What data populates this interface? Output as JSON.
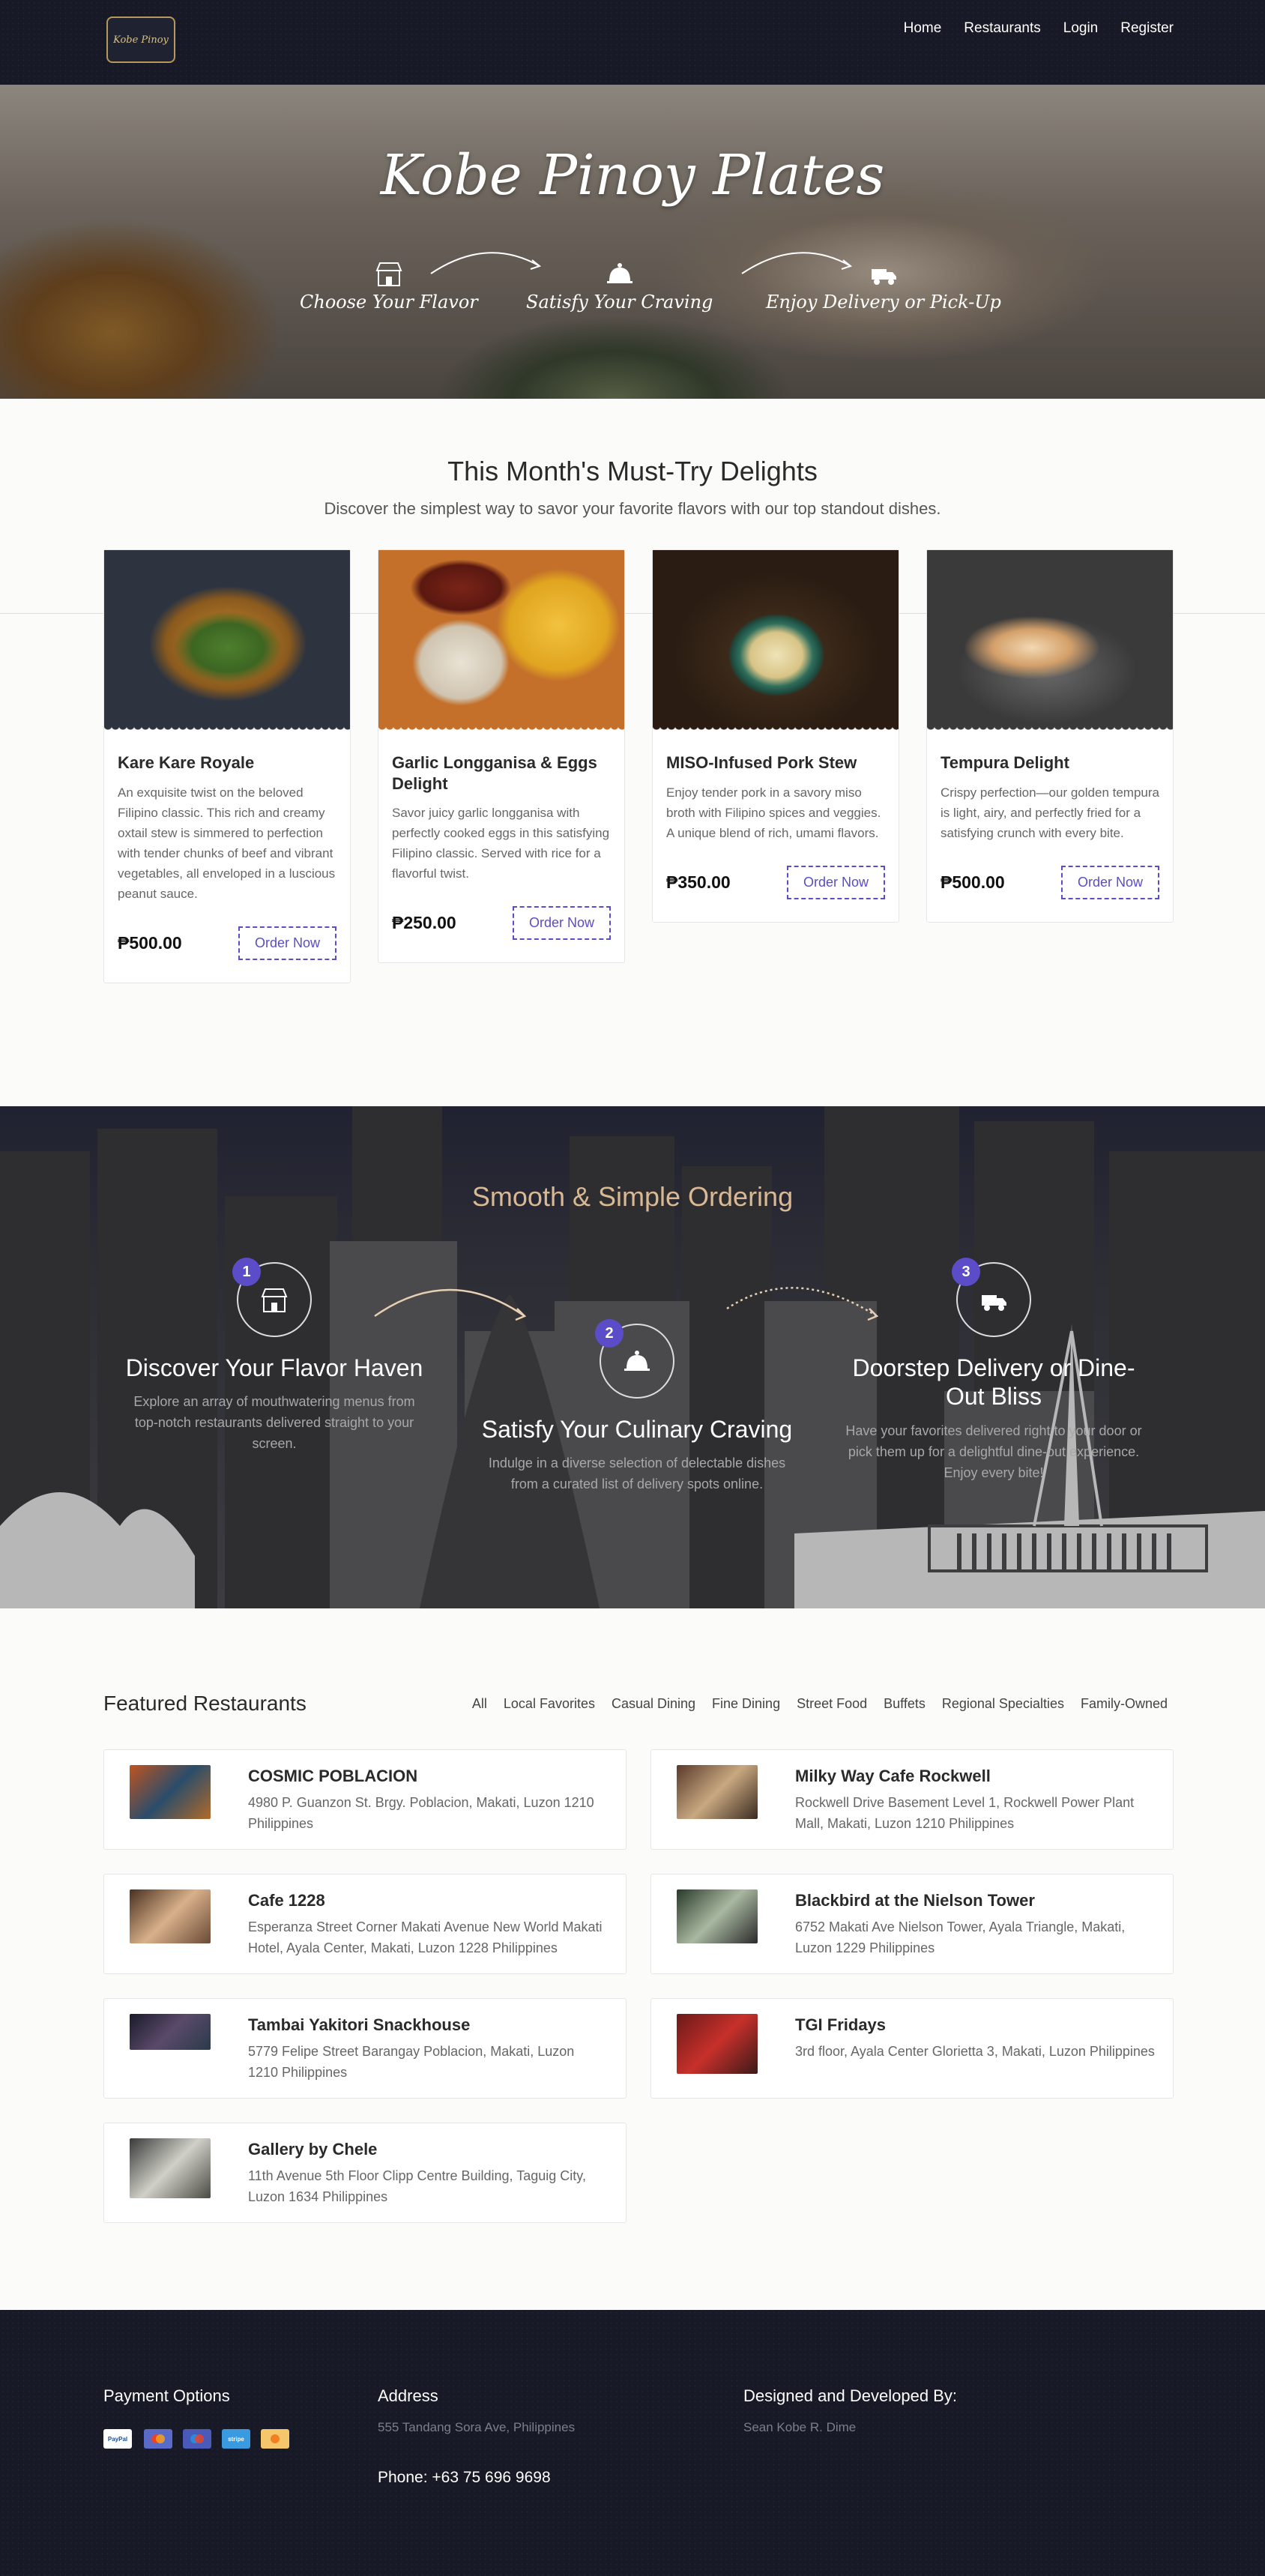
{
  "nav": {
    "logo_text": "Kobe Pinoy",
    "links": [
      "Home",
      "Restaurants",
      "Login",
      "Register"
    ]
  },
  "hero": {
    "title": "Kobe Pinoy Plates",
    "steps": [
      "Choose Your Flavor",
      "Satisfy Your Craving",
      "Enjoy Delivery or Pick-Up"
    ]
  },
  "must_try": {
    "title": "This Month's Must-Try Delights",
    "subtitle": "Discover the simplest way to savor your favorite flavors with our top standout dishes.",
    "dishes": [
      {
        "name": "Kare Kare Royale",
        "desc": "An exquisite twist on the beloved Filipino classic. This rich and creamy oxtail stew is simmered to perfection with tender chunks of beef and vibrant vegetables, all enveloped in a luscious peanut sauce.",
        "price": "₱500.00",
        "button": "Order Now"
      },
      {
        "name": "Garlic Longganisa & Eggs Delight",
        "desc": "Savor juicy garlic longganisa with perfectly cooked eggs in this satisfying Filipino classic. Served with rice for a flavorful twist.",
        "price": "₱250.00",
        "button": "Order Now"
      },
      {
        "name": "MISO-Infused Pork Stew",
        "desc": "Enjoy tender pork in a savory miso broth with Filipino spices and veggies. A unique blend of rich, umami flavors.",
        "price": "₱350.00",
        "button": "Order Now"
      },
      {
        "name": "Tempura Delight",
        "desc": "Crispy perfection—our golden tempura is light, airy, and perfectly fried for a satisfying crunch with every bite.",
        "price": "₱500.00",
        "button": "Order Now"
      }
    ]
  },
  "ordering": {
    "title": "Smooth & Simple Ordering",
    "steps": [
      {
        "num": "1",
        "title": "Discover Your Flavor Haven",
        "desc": "Explore an array of mouthwatering menus from top-notch restaurants delivered straight to your screen."
      },
      {
        "num": "2",
        "title": "Satisfy Your Culinary Craving",
        "desc": "Indulge in a diverse selection of delectable dishes from a curated list of delivery spots online."
      },
      {
        "num": "3",
        "title": "Doorstep Delivery or Dine-Out Bliss",
        "desc": "Have your favorites delivered right to your door or pick them up for a delightful dine-out experience. Enjoy every bite!"
      }
    ]
  },
  "featured": {
    "title": "Featured Restaurants",
    "filters": [
      "All",
      "Local Favorites",
      "Casual Dining",
      "Fine Dining",
      "Street Food",
      "Buffets",
      "Regional Specialties",
      "Family-Owned"
    ],
    "restaurants": [
      {
        "name": "COSMIC POBLACION",
        "address": "4980 P. Guanzon St. Brgy. Poblacion, Makati, Luzon 1210 Philippines"
      },
      {
        "name": "Milky Way Cafe Rockwell",
        "address": "Rockwell Drive Basement Level 1, Rockwell Power Plant Mall, Makati, Luzon 1210 Philippines"
      },
      {
        "name": "Cafe 1228",
        "address": "Esperanza Street Corner Makati Avenue New World Makati Hotel, Ayala Center, Makati, Luzon 1228 Philippines"
      },
      {
        "name": "Blackbird at the Nielson Tower",
        "address": "6752 Makati Ave Nielson Tower, Ayala Triangle, Makati, Luzon 1229 Philippines"
      },
      {
        "name": "Tambai Yakitori Snackhouse",
        "address": "5779 Felipe Street Barangay Poblacion, Makati, Luzon 1210 Philippines"
      },
      {
        "name": "TGI Fridays",
        "address": "3rd floor, Ayala Center Glorietta 3, Makati, Luzon Philippines"
      },
      {
        "name": "Gallery by Chele",
        "address": "11th Avenue 5th Floor Clipp Centre Building, Taguig City, Luzon 1634 Philippines"
      }
    ]
  },
  "footer": {
    "payment_title": "Payment Options",
    "payment_methods": [
      "PayPal",
      "Mastercard",
      "Maestro",
      "Stripe",
      "Discover"
    ],
    "address_title": "Address",
    "address": "555 Tandang Sora Ave, Philippines",
    "phone": "Phone: +63 75 696 9698",
    "designer_title": "Designed and Developed By:",
    "designer": "Sean Kobe R. Dime"
  },
  "colors": {
    "accent": "#5b4cc8",
    "nav_bg": "#171a26",
    "ordering_title": "#d9b894"
  }
}
